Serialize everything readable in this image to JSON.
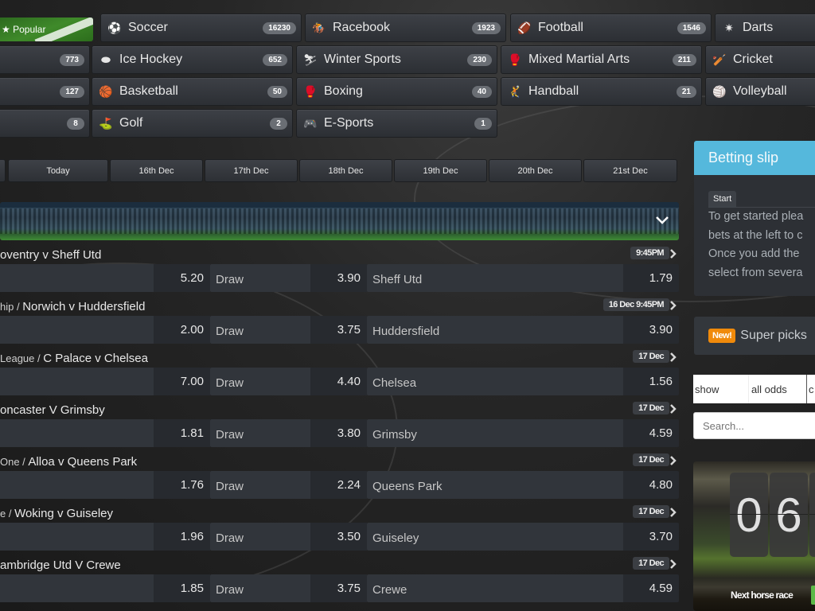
{
  "popular": {
    "label": "Popular",
    "icon": "star-icon"
  },
  "sports": [
    {
      "name": "Soccer",
      "count": "16230",
      "icon": "soccer-ball-icon"
    },
    {
      "name": "Racebook",
      "count": "1923",
      "icon": "horse-racing-icon"
    },
    {
      "name": "Football",
      "count": "1546",
      "icon": "american-football-icon"
    },
    {
      "name": "Darts",
      "count": "",
      "icon": "darts-icon"
    },
    {
      "name": "",
      "count": "773",
      "icon": ""
    },
    {
      "name": "Ice Hockey",
      "count": "652",
      "icon": "hockey-puck-icon"
    },
    {
      "name": "Winter Sports",
      "count": "230",
      "icon": "skiing-icon"
    },
    {
      "name": "Mixed Martial Arts",
      "count": "211",
      "icon": "mma-gloves-icon"
    },
    {
      "name": "Cricket",
      "count": "",
      "icon": "cricket-bat-icon"
    },
    {
      "name": "",
      "count": "127",
      "icon": ""
    },
    {
      "name": "Basketball",
      "count": "50",
      "icon": "basketball-icon"
    },
    {
      "name": "Boxing",
      "count": "40",
      "icon": "boxing-glove-icon"
    },
    {
      "name": "Handball",
      "count": "21",
      "icon": "handball-icon"
    },
    {
      "name": "Volleyball",
      "count": "",
      "icon": "volleyball-icon"
    },
    {
      "name": "",
      "count": "8",
      "icon": ""
    },
    {
      "name": "Golf",
      "count": "2",
      "icon": "golf-icon"
    },
    {
      "name": "E-Sports",
      "count": "1",
      "icon": "gamepad-icon"
    }
  ],
  "date_tabs": [
    "",
    "Today",
    "16th Dec",
    "17th Dec",
    "18th Dec",
    "19th Dec",
    "20th Dec",
    "21st Dec"
  ],
  "matches": [
    {
      "league": "",
      "title": "oventry v Sheff Utd",
      "time": "9:45PM",
      "home": "",
      "home_odds": "5.20",
      "draw": "Draw",
      "draw_odds": "3.90",
      "away": "Sheff Utd",
      "away_odds": "1.79"
    },
    {
      "league": "hip / ",
      "title": "Norwich v Huddersfield",
      "time": "16 Dec 9:45PM",
      "home": "",
      "home_odds": "2.00",
      "draw": "Draw",
      "draw_odds": "3.75",
      "away": "Huddersfield",
      "away_odds": "3.90"
    },
    {
      "league": "League / ",
      "title": "C Palace v Chelsea",
      "time": "17 Dec",
      "home": "",
      "home_odds": "7.00",
      "draw": "Draw",
      "draw_odds": "4.40",
      "away": "Chelsea",
      "away_odds": "1.56"
    },
    {
      "league": "",
      "title": "oncaster V Grimsby",
      "time": "17 Dec",
      "home": "",
      "home_odds": "1.81",
      "draw": "Draw",
      "draw_odds": "3.80",
      "away": "Grimsby",
      "away_odds": "4.59"
    },
    {
      "league": "One / ",
      "title": "Alloa v Queens Park",
      "time": "17 Dec",
      "home": "",
      "home_odds": "1.76",
      "draw": "Draw",
      "draw_odds": "2.24",
      "away": "Queens Park",
      "away_odds": "4.80"
    },
    {
      "league": "e / ",
      "title": "Woking v Guiseley",
      "time": "17 Dec",
      "home": "",
      "home_odds": "1.96",
      "draw": "Draw",
      "draw_odds": "3.50",
      "away": "Guiseley",
      "away_odds": "3.70"
    },
    {
      "league": "",
      "title": "ambridge Utd V Crewe",
      "time": "17 Dec",
      "home": "",
      "home_odds": "1.85",
      "draw": "Draw",
      "draw_odds": "3.75",
      "away": "Crewe",
      "away_odds": "4.59"
    }
  ],
  "betting_slip": {
    "title": "Betting slip",
    "tab": "Start",
    "lines": [
      "To get started plea",
      "bets at the left to c",
      "Once you add the",
      "select from severa"
    ]
  },
  "super_picks": {
    "badge": "New!",
    "label": "Super picks"
  },
  "odds_filter": {
    "show": "show",
    "all_odds": "all odds",
    "next": "c"
  },
  "search": {
    "placeholder": "Search..."
  },
  "next_race": {
    "digits": [
      "0",
      "6"
    ],
    "label": "Next horse race"
  },
  "colors": {
    "slip_header": "#55b8dc",
    "new_badge": "#f08a0b",
    "race_button": "#5cb947"
  }
}
